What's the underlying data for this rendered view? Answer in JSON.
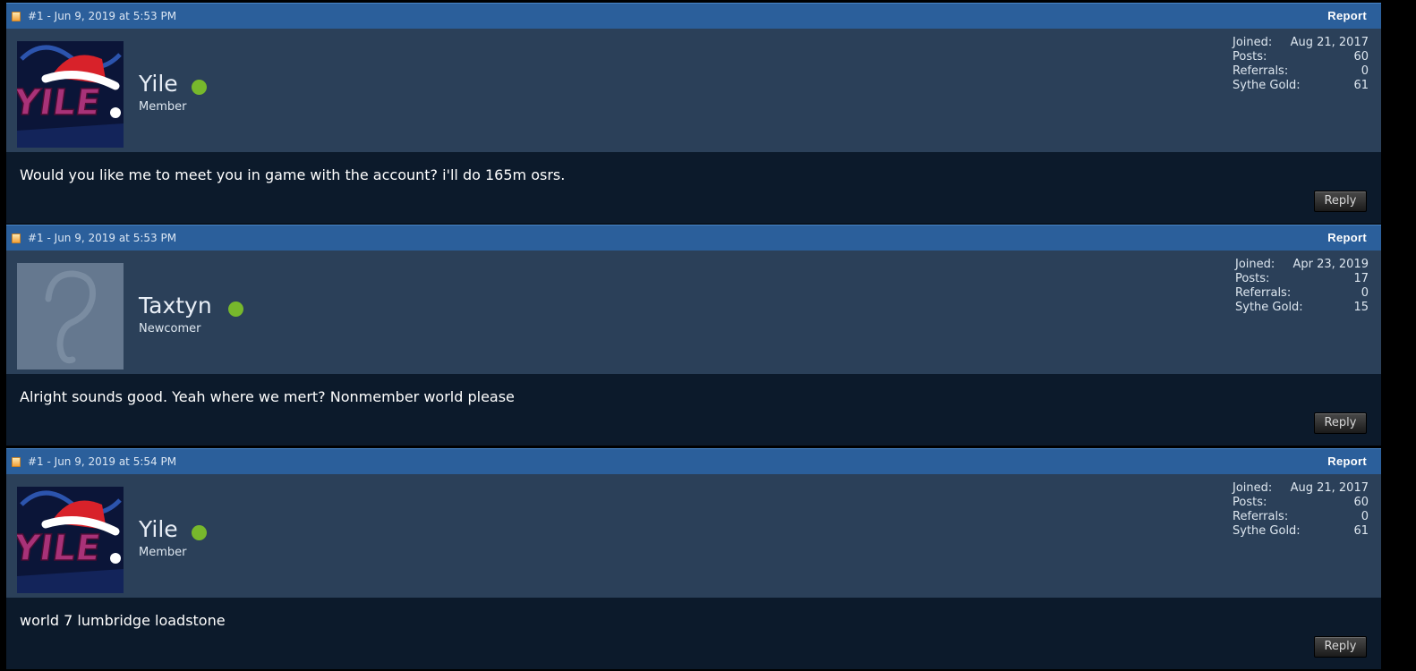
{
  "posts": [
    {
      "meta": "#1 - Jun 9, 2019 at 5:53 PM",
      "report_label": "Report",
      "username": "Yile",
      "rank": "Member",
      "avatar": "yile",
      "stats": [
        {
          "label": "Joined:",
          "value": "Aug 21, 2017"
        },
        {
          "label": "Posts:",
          "value": "60"
        },
        {
          "label": "Referrals:",
          "value": "0"
        },
        {
          "label": "Sythe Gold:",
          "value": "61"
        }
      ],
      "message": "Would you like me to meet you in game with the account? i'll do 165m osrs.",
      "reply_label": "Reply"
    },
    {
      "meta": "#1 - Jun 9, 2019 at 5:53 PM",
      "report_label": "Report",
      "username": "Taxtyn",
      "rank": "Newcomer",
      "avatar": "default",
      "stats": [
        {
          "label": "Joined:",
          "value": "Apr 23, 2019"
        },
        {
          "label": "Posts:",
          "value": "17"
        },
        {
          "label": "Referrals:",
          "value": "0"
        },
        {
          "label": "Sythe Gold:",
          "value": "15"
        }
      ],
      "message": "Alright sounds good. Yeah where we mert? Nonmember world please",
      "reply_label": "Reply"
    },
    {
      "meta": "#1 - Jun 9, 2019 at 5:54 PM",
      "report_label": "Report",
      "username": "Yile",
      "rank": "Member",
      "avatar": "yile",
      "stats": [
        {
          "label": "Joined:",
          "value": "Aug 21, 2017"
        },
        {
          "label": "Posts:",
          "value": "60"
        },
        {
          "label": "Referrals:",
          "value": "0"
        },
        {
          "label": "Sythe Gold:",
          "value": "61"
        }
      ],
      "message": "world 7 lumbridge loadstone",
      "reply_label": "Reply"
    }
  ],
  "avatars": {
    "yile": {
      "text": "YILE",
      "text_color": "#b0387a",
      "hat_color": "#d8222a"
    }
  },
  "colors": {
    "header": "#2b5f9b",
    "user_panel": "#2b4059",
    "message_bg": "#0c1a2b",
    "online": "#77b82c"
  }
}
